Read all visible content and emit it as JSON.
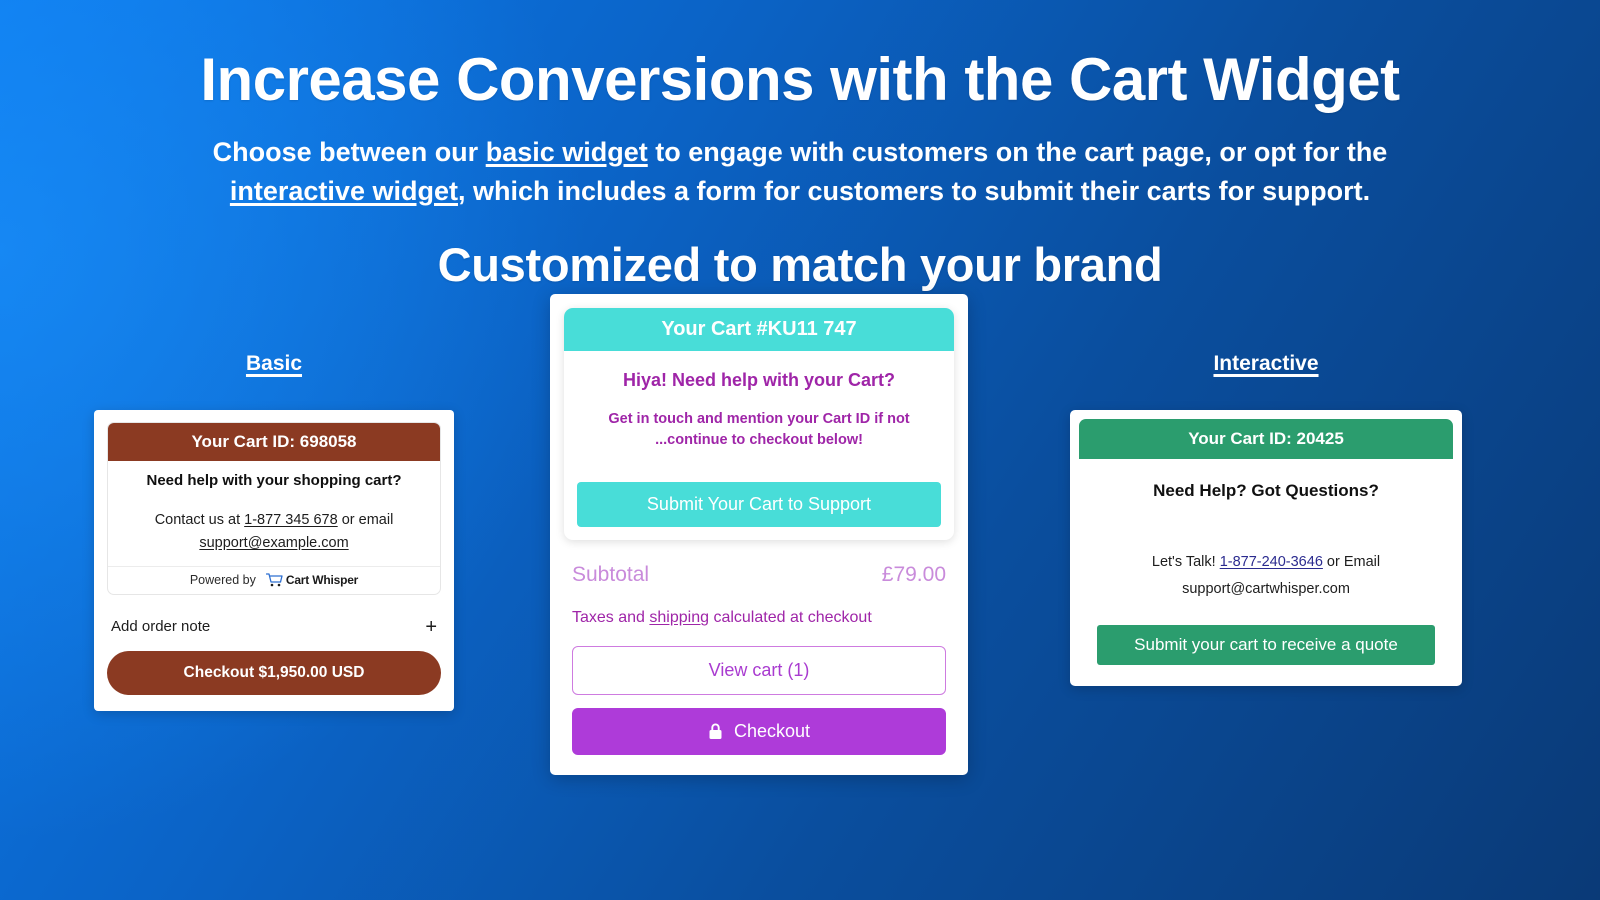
{
  "hero": {
    "title": "Increase Conversions with the Cart Widget",
    "sub_line1_a": "Choose between our ",
    "sub_line1_em": "basic widget",
    "sub_line1_b": " to engage with customers on the cart page, or opt for the",
    "sub_line2_em": "interactive widget",
    "sub_line2_b": ", which includes a form for customers to submit their carts for support.",
    "title2": "Customized to match your brand"
  },
  "basic": {
    "label": "Basic",
    "header": "Your Cart ID: 698058",
    "question": "Need help with your shopping cart?",
    "contact_prefix": "Contact us at ",
    "phone": "1-877 345 678",
    "contact_mid": " or email",
    "email": "support@example.com",
    "powered_by": "Powered by",
    "brand_name": "Cart Whisper",
    "order_note_label": "Add order note",
    "order_note_icon": "plus-icon",
    "checkout_label": "Checkout $1,950.00 USD",
    "header_color": "#8B3A22",
    "button_color": "#8B3A22"
  },
  "middle": {
    "header": "Your Cart #KU11 747",
    "question": "Hiya! Need help with your Cart?",
    "note": "Get in touch and mention your Cart ID if not ...continue to checkout below!",
    "submit_label": "Submit Your Cart to Support",
    "subtotal_label": "Subtotal",
    "subtotal_value": "£79.00",
    "taxes_prefix": "Taxes and ",
    "taxes_link": "shipping",
    "taxes_suffix": " calculated at checkout",
    "view_cart_label": "View cart (1)",
    "checkout_label": "Checkout",
    "checkout_icon": "lock-icon",
    "header_color": "#48DDD8",
    "accent_color": "#9F25A8",
    "checkout_color": "#AE3BD9"
  },
  "interactive": {
    "label": "Interactive",
    "header": "Your Cart ID: 20425",
    "question": "Need Help? Got Questions?",
    "contact_prefix": "Let's Talk! ",
    "phone": "1-877-240-3646",
    "contact_mid": " or Email",
    "email": "support@cartwhisper.com",
    "submit_label": "Submit your cart to receive a quote",
    "header_color": "#2B9D6E",
    "button_color": "#2B9D6E"
  }
}
